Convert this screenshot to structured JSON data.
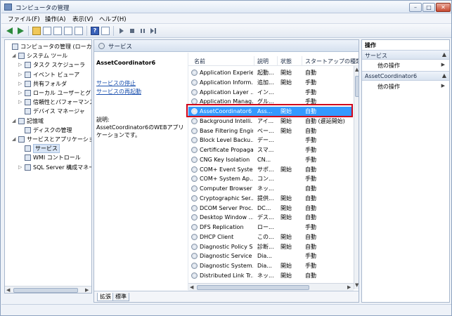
{
  "window": {
    "title": "コンピュータの管理"
  },
  "menu": [
    "ファイル(F)",
    "操作(A)",
    "表示(V)",
    "ヘルプ(H)"
  ],
  "tree": [
    {
      "label": "コンピュータの管理 (ローカル)",
      "level": 0,
      "exp": ""
    },
    {
      "label": "システム ツール",
      "level": 1,
      "exp": "◢"
    },
    {
      "label": "タスク スケジューラ",
      "level": 2,
      "exp": "▷"
    },
    {
      "label": "イベント ビューア",
      "level": 2,
      "exp": "▷"
    },
    {
      "label": "共有フォルダ",
      "level": 2,
      "exp": "▷"
    },
    {
      "label": "ローカル ユーザーとグループ",
      "level": 2,
      "exp": "▷"
    },
    {
      "label": "信頼性とパフォーマンス",
      "level": 2,
      "exp": "▷"
    },
    {
      "label": "デバイス マネージャ",
      "level": 2,
      "exp": ""
    },
    {
      "label": "記憶域",
      "level": 1,
      "exp": "◢"
    },
    {
      "label": "ディスクの管理",
      "level": 2,
      "exp": ""
    },
    {
      "label": "サービスとアプリケーション",
      "level": 1,
      "exp": "◢"
    },
    {
      "label": "サービス",
      "level": 2,
      "exp": "",
      "selected": true
    },
    {
      "label": "WMI コントロール",
      "level": 2,
      "exp": ""
    },
    {
      "label": "SQL Server 構成マネージャ",
      "level": 2,
      "exp": "▷"
    }
  ],
  "center": {
    "header": "サービス",
    "description": {
      "service_name": "AssetCoordinator6",
      "link_stop": "サービスの停止",
      "link_restart": "サービスの再起動",
      "label": "説明:",
      "text": "AssetCoordinator6のWEBアプリケーションです。"
    },
    "columns": [
      "名前",
      "説明",
      "状態",
      "スタートアップの種類"
    ],
    "rows": [
      {
        "name": "Application Experie...",
        "desc": "起動...",
        "status": "開始",
        "startup": "自動"
      },
      {
        "name": "Application Inform...",
        "desc": "追加...",
        "status": "開始",
        "startup": "手動"
      },
      {
        "name": "Application Layer ...",
        "desc": "イン...",
        "status": "",
        "startup": "手動"
      },
      {
        "name": "Application Manag...",
        "desc": "グル...",
        "status": "",
        "startup": "手動"
      },
      {
        "name": "AssetCoordinator6",
        "desc": "Ass...",
        "status": "開始",
        "startup": "自動",
        "selected": true
      },
      {
        "name": "Background Intelli...",
        "desc": "アイ...",
        "status": "開始",
        "startup": "自動 (遅延開始)"
      },
      {
        "name": "Base Filtering Engine",
        "desc": "ベー...",
        "status": "開始",
        "startup": "自動"
      },
      {
        "name": "Block Level Backu...",
        "desc": "デー...",
        "status": "",
        "startup": "手動"
      },
      {
        "name": "Certificate Propaga...",
        "desc": "スマ...",
        "status": "",
        "startup": "手動"
      },
      {
        "name": "CNG Key Isolation",
        "desc": "CN...",
        "status": "",
        "startup": "手動"
      },
      {
        "name": "COM+ Event System",
        "desc": "サポ...",
        "status": "開始",
        "startup": "自動"
      },
      {
        "name": "COM+ System Ap...",
        "desc": "コン...",
        "status": "",
        "startup": "手動"
      },
      {
        "name": "Computer Browser",
        "desc": "ネッ...",
        "status": "",
        "startup": "自動"
      },
      {
        "name": "Cryptographic Ser...",
        "desc": "提供...",
        "status": "開始",
        "startup": "自動"
      },
      {
        "name": "DCOM Server Proc...",
        "desc": "DC...",
        "status": "開始",
        "startup": "自動"
      },
      {
        "name": "Desktop Window ...",
        "desc": "デス...",
        "status": "開始",
        "startup": "自動"
      },
      {
        "name": "DFS Replication",
        "desc": "ロー...",
        "status": "",
        "startup": "手動"
      },
      {
        "name": "DHCP Client",
        "desc": "この...",
        "status": "開始",
        "startup": "自動"
      },
      {
        "name": "Diagnostic Policy S...",
        "desc": "診断...",
        "status": "開始",
        "startup": "自動"
      },
      {
        "name": "Diagnostic Service ...",
        "desc": "Dia...",
        "status": "",
        "startup": "手動"
      },
      {
        "name": "Diagnostic System...",
        "desc": "Dia...",
        "status": "開始",
        "startup": "手動"
      },
      {
        "name": "Distributed Link Tr...",
        "desc": "ネッ...",
        "status": "開始",
        "startup": "自動"
      }
    ],
    "tabs": [
      "拡張",
      "標準"
    ]
  },
  "actions": {
    "title": "操作",
    "sections": [
      {
        "label": "サービス",
        "items": [
          "他の操作"
        ]
      },
      {
        "label": "AssetCoordinator6",
        "items": [
          "他の操作"
        ]
      }
    ]
  }
}
